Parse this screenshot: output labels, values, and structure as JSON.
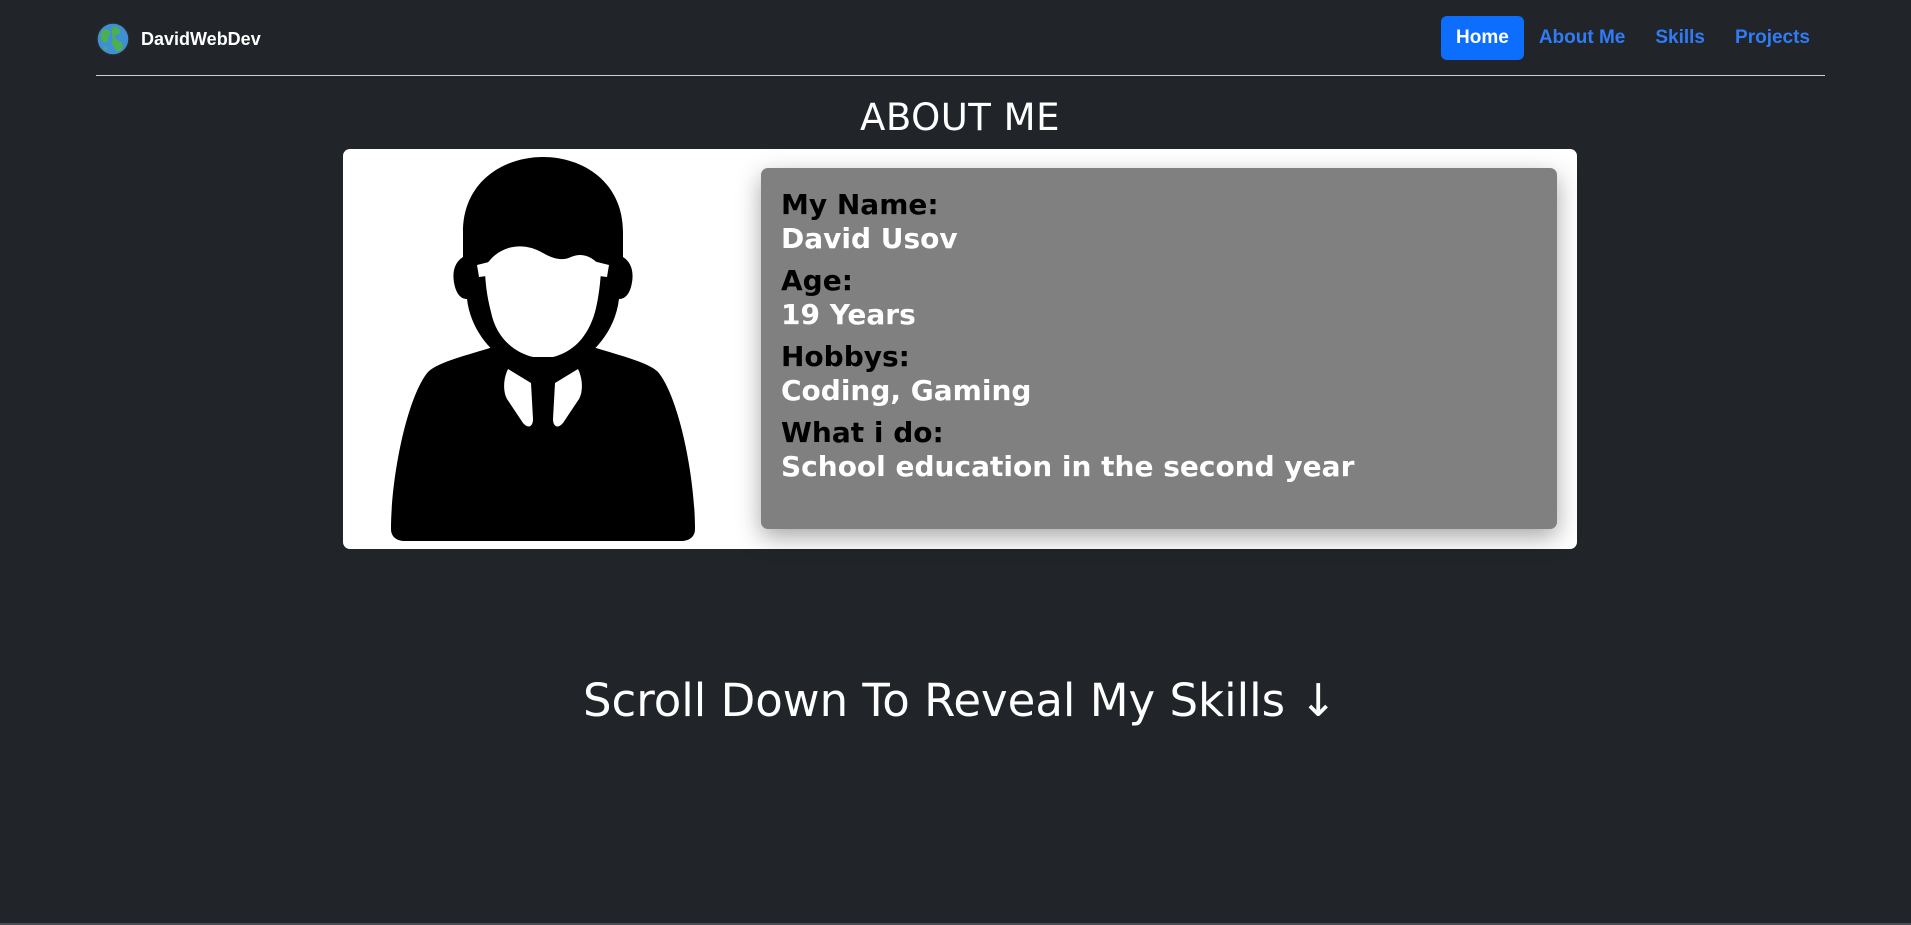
{
  "nav": {
    "brand": "DavidWebDev",
    "brand_icon": "globe-icon",
    "links": [
      {
        "label": "Home",
        "active": true
      },
      {
        "label": "About Me",
        "active": false
      },
      {
        "label": "Skills",
        "active": false
      },
      {
        "label": "Projects",
        "active": false
      }
    ]
  },
  "about": {
    "title": "ABOUT ME",
    "avatar_icon": "person-avatar-icon",
    "fields": [
      {
        "label": "My Name:",
        "value": "David Usov"
      },
      {
        "label": "Age:",
        "value": "19 Years"
      },
      {
        "label": "Hobbys:",
        "value": "Coding, Gaming"
      },
      {
        "label": "What i do:",
        "value": "School education in the second year"
      }
    ]
  },
  "scroll_hint": "Scroll Down To Reveal My Skills ↓",
  "colors": {
    "background": "#212529",
    "accent": "#0d6efd",
    "link": "#2f7cf6",
    "info_panel": "#808080"
  }
}
